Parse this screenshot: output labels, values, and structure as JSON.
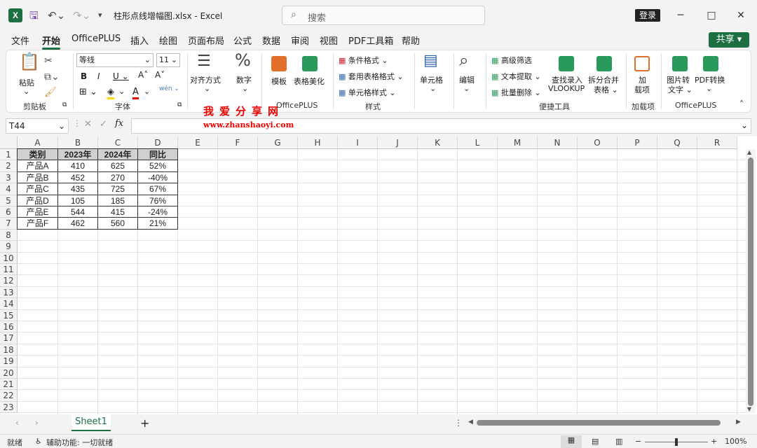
{
  "titlebar": {
    "app_letter": "X",
    "doc_title": "柱形点线增幅图.xlsx  -  Excel",
    "search_placeholder": "搜索",
    "login_label": "登录",
    "minimize": "─",
    "maximize": "□",
    "close": "✕"
  },
  "menu": [
    "文件",
    "开始",
    "OfficePLUS",
    "插入",
    "绘图",
    "页面布局",
    "公式",
    "数据",
    "审阅",
    "视图",
    "PDF工具箱",
    "帮助"
  ],
  "menu_active": "开始",
  "share_label": "共享",
  "ribbon": {
    "paste": "粘贴",
    "clipboard_group": "剪贴板",
    "font_name": "等线",
    "font_size": "11",
    "font_group": "字体",
    "align": "对齐方式",
    "number": "数字",
    "template": "模板",
    "table_beautify": "表格美化",
    "officeplus_group": "OfficePLUS",
    "cond_format": "条件格式",
    "table_format": "套用表格格式",
    "cell_style": "单元格样式",
    "style_group": "样式",
    "cell": "单元格",
    "edit": "编辑",
    "adv_filter": "高级筛选",
    "text_extract": "文本提取",
    "batch_delete": "批量删除",
    "lookup": "查找录入",
    "lookup2": "VLOOKUP",
    "split_merge": "拆分合并",
    "split_merge2": "表格",
    "quick_tools_group": "便捷工具",
    "addin": "加",
    "addin2": "载项",
    "addin_group": "加载项",
    "img2text": "图片转",
    "img2text2": "文字",
    "pdf_convert": "PDF转换",
    "officeplus_group2": "OfficePLUS"
  },
  "watermark": {
    "line1": "我爱分享网",
    "line2": "www.zhanshaoyi.com"
  },
  "formula_bar": {
    "name_box": "T44",
    "fx": "fx",
    "cancel": "✕",
    "enter": "✓"
  },
  "columns": [
    "A",
    "B",
    "C",
    "D",
    "E",
    "F",
    "G",
    "H",
    "I",
    "J",
    "K",
    "L",
    "M",
    "N",
    "O",
    "P",
    "Q",
    "R"
  ],
  "rows": [
    "1",
    "2",
    "3",
    "4",
    "5",
    "6",
    "7",
    "8",
    "9",
    "10",
    "11",
    "12",
    "13",
    "14",
    "15",
    "16",
    "17",
    "18",
    "19",
    "20",
    "21",
    "22",
    "23"
  ],
  "table": {
    "headers": [
      "类别",
      "2023年",
      "2024年",
      "同比"
    ],
    "rows": [
      [
        "产品A",
        "410",
        "625",
        "52%"
      ],
      [
        "产品B",
        "452",
        "270",
        "-40%"
      ],
      [
        "产品C",
        "435",
        "725",
        "67%"
      ],
      [
        "产品D",
        "105",
        "185",
        "76%"
      ],
      [
        "产品E",
        "544",
        "415",
        "-24%"
      ],
      [
        "产品F",
        "462",
        "560",
        "21%"
      ]
    ]
  },
  "sheet_tabs": {
    "active": "Sheet1",
    "add": "+"
  },
  "status": {
    "ready": "就绪",
    "accessibility": "辅助功能: 一切就绪",
    "zoom": "100%"
  }
}
